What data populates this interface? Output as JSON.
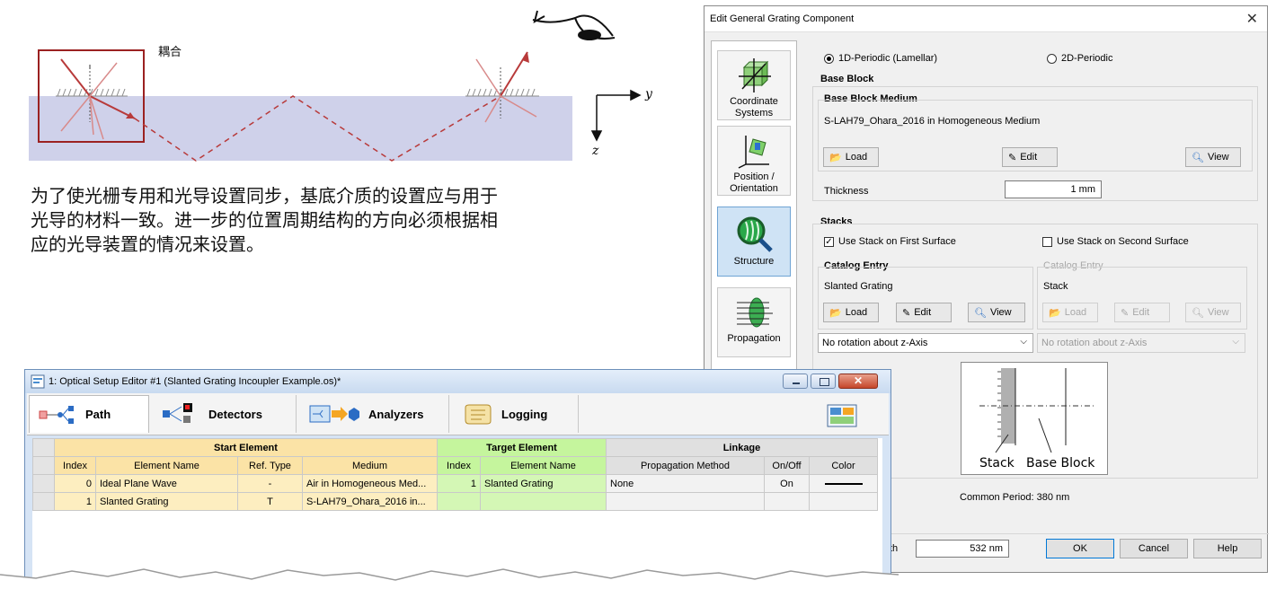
{
  "illustration": {
    "label_coupling": "耦合",
    "axis_y": "y",
    "axis_z": "z"
  },
  "caption": {
    "line1": "为了使光栅专用和光导设置同步，基底介质的设置应与用于",
    "line2": "光导的材料一致。进一步的位置周期结构的方向必须根据相",
    "line3": "应的光导装置的情况来设置。"
  },
  "dialog": {
    "title": "Edit General Grating Component",
    "close_glyph": "✕",
    "sidebar": {
      "items": [
        {
          "label1": "Coordinate",
          "label2": "Systems"
        },
        {
          "label1": "Position /",
          "label2": "Orientation"
        },
        {
          "label1": "Structure",
          "label2": ""
        },
        {
          "label1": "Propagation",
          "label2": ""
        }
      ]
    },
    "periodic": {
      "option1": "1D-Periodic (Lamellar)",
      "option2": "2D-Periodic"
    },
    "base_block": {
      "group": "Base Block",
      "medium_group": "Base Block Medium",
      "medium_value": "S-LAH79_Ohara_2016 in Homogeneous Medium",
      "load": "Load",
      "edit": "Edit",
      "view": "View",
      "thickness_label": "Thickness",
      "thickness_value": "1 mm"
    },
    "stacks": {
      "group": "Stacks",
      "first_label": "Use Stack on First Surface",
      "second_label": "Use Stack on Second Surface",
      "left": {
        "catalog_label": "Catalog Entry",
        "entry": "Slanted Grating",
        "load": "Load",
        "edit": "Edit",
        "view": "View",
        "rotation": "No rotation about z-Axis"
      },
      "right": {
        "catalog_label": "Catalog Entry",
        "entry": "Stack",
        "load": "Load",
        "edit": "Edit",
        "view": "View",
        "rotation": "No rotation about z-Axis"
      },
      "diagram_stack": "Stack",
      "diagram_base": "Base Block",
      "common_period": "Common Period: 380 nm"
    },
    "footer": {
      "wavelength_partial": "th",
      "wavelength_value": "532 nm",
      "ok": "OK",
      "cancel": "Cancel",
      "help": "Help"
    }
  },
  "editor": {
    "title": "1: Optical Setup Editor #1 (Slanted Grating Incoupler Example.os)*",
    "tabs": [
      {
        "label": "Path"
      },
      {
        "label": "Detectors"
      },
      {
        "label": "Analyzers"
      },
      {
        "label": "Logging"
      }
    ],
    "groups": {
      "start": "Start Element",
      "target": "Target Element",
      "linkage": "Linkage"
    },
    "columns": [
      "Index",
      "Element Name",
      "Ref. Type",
      "Medium",
      "Index",
      "Element Name",
      "Propagation Method",
      "On/Off",
      "Color"
    ],
    "rows": [
      {
        "index": "0",
        "name": "Ideal Plane Wave",
        "ref": "-",
        "medium": "Air in Homogeneous Med...",
        "t_index": "1",
        "t_name": "Slanted Grating",
        "method": "None",
        "onoff": "On"
      },
      {
        "index": "1",
        "name": "Slanted Grating",
        "ref": "T",
        "medium": "S-LAH79_Ohara_2016  in...",
        "t_index": "",
        "t_name": "",
        "method": "",
        "onoff": ""
      }
    ],
    "colors": {
      "start": "#fbe3a6",
      "target": "#c5f59d",
      "linkage": "#e0e0e0"
    }
  }
}
